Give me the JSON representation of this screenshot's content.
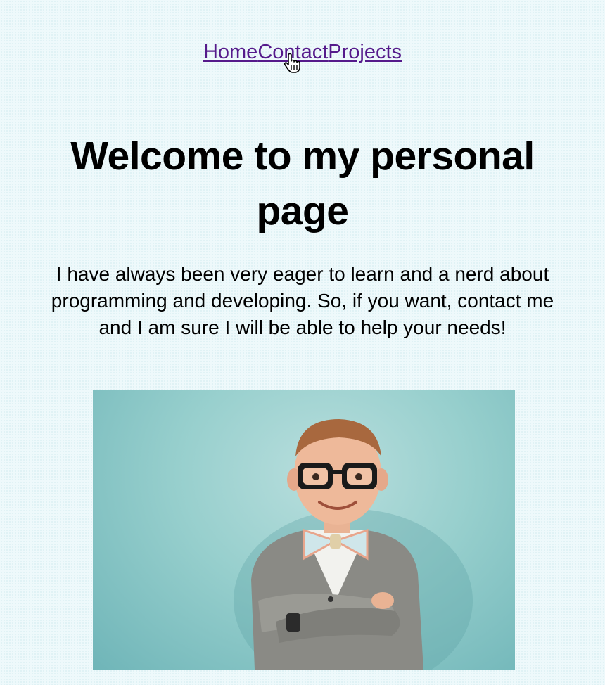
{
  "nav": {
    "links": [
      {
        "label": "Home"
      },
      {
        "label": "Contact"
      },
      {
        "label": "Projects"
      }
    ]
  },
  "main": {
    "title": "Welcome to my personal page",
    "intro": "I have always been very eager to learn and a nerd about programming and developing. So, if you want, contact me and I am sure I will be able to help your needs!"
  },
  "colors": {
    "link": "#551a8b",
    "background": "#eef9fb",
    "photo_background": "#97cfcd"
  },
  "icons": {
    "cursor": "hand-pointer-icon"
  }
}
